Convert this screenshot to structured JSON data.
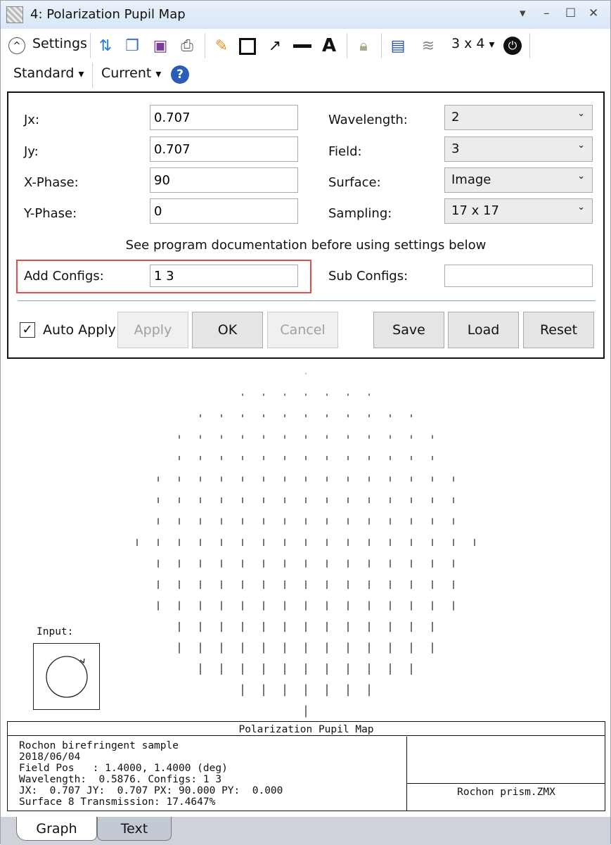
{
  "window": {
    "title": "4: Polarization Pupil Map",
    "controls": [
      "▾",
      "–",
      "☐",
      "✕"
    ]
  },
  "toolbar": {
    "settings_label": "Settings",
    "layout_label": "3 x 4",
    "standard_label": "Standard",
    "current_label": "Current",
    "icons": [
      "refresh-icon",
      "copy-icon",
      "save-icon",
      "print-icon",
      "pencil-icon",
      "rectangle-icon",
      "arrow-icon",
      "line-icon",
      "text-icon",
      "lock-icon",
      "window-icon",
      "layers-icon"
    ]
  },
  "settings": {
    "jx_label": "Jx:",
    "jx": "0.707",
    "jy_label": "Jy:",
    "jy": "0.707",
    "xphase_label": "X-Phase:",
    "xphase": "90",
    "yphase_label": "Y-Phase:",
    "yphase": "0",
    "wavelength_label": "Wavelength:",
    "wavelength": "2",
    "field_label": "Field:",
    "field": "3",
    "surface_label": "Surface:",
    "surface": "Image",
    "sampling_label": "Sampling:",
    "sampling": "17 x 17",
    "note": "See program documentation before using settings below",
    "add_configs_label": "Add Configs:",
    "add_configs": "1 3",
    "sub_configs_label": "Sub Configs:",
    "sub_configs": "",
    "auto_apply_label": "Auto Apply",
    "auto_apply": true,
    "apply": "Apply",
    "ok": "OK",
    "cancel": "Cancel",
    "save": "Save",
    "load": "Load",
    "reset": "Reset",
    "highlight_color": "#e05050"
  },
  "chart_data": {
    "type": "polarization-pupil-map",
    "sampling": "17 x 17",
    "row_counts": [
      1,
      7,
      11,
      13,
      13,
      15,
      15,
      15,
      17,
      15,
      15,
      15,
      13,
      13,
      11,
      7,
      1
    ],
    "row_relative_amplitude": [
      0.05,
      0.18,
      0.25,
      0.3,
      0.36,
      0.42,
      0.48,
      0.54,
      0.6,
      0.66,
      0.72,
      0.78,
      0.84,
      0.9,
      0.95,
      1.0,
      1.0
    ],
    "orientation": "vertical",
    "input_label": "Input:",
    "input_polarization": "circular"
  },
  "footer": {
    "title": "Polarization Pupil Map",
    "lines": [
      "Rochon birefringent sample",
      "2018/06/04",
      "Field Pos   : 1.4000, 1.4000 (deg)",
      "Wavelength:  0.5876. Configs: 1 3",
      "JX:  0.707 JY:  0.707 PX: 90.000 PY:  0.000",
      "Surface 8 Transmission: 17.4647%"
    ],
    "file": "Rochon prism.ZMX"
  },
  "tabs": [
    {
      "label": "Graph",
      "active": true
    },
    {
      "label": "Text",
      "active": false
    }
  ]
}
